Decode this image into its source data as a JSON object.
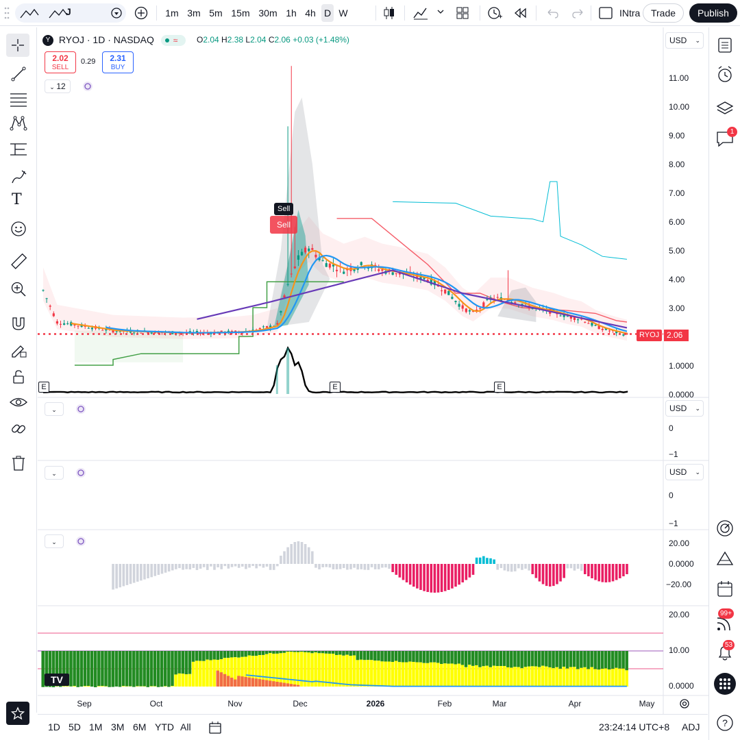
{
  "toolbar": {
    "symbol_partial": "J",
    "intervals": [
      "1m",
      "3m",
      "5m",
      "15m",
      "30m",
      "1h",
      "4h",
      "D",
      "W"
    ],
    "active_interval": "D",
    "indicators_label": "INtra",
    "trade_label": "Trade",
    "publish_label": "Publish"
  },
  "legend": {
    "logo_letter": "Y",
    "title": "RYOJ · 1D · NASDAQ",
    "o_label": "O",
    "o_val": "2.04",
    "h_label": "H",
    "h_val": "2.38",
    "l_label": "L",
    "l_val": "2.04",
    "c_label": "C",
    "c_val": "2.06",
    "change": "+0.03 (+1.48%)",
    "sell_price": "2.02",
    "sell_label": "SELL",
    "spread": "0.29",
    "buy_price": "2.31",
    "buy_label": "BUY",
    "collapse_count": "12"
  },
  "price_axis": {
    "currency": "USD",
    "ticks": [
      "11.00",
      "10.00",
      "9.00",
      "8.00",
      "7.00",
      "6.00",
      "5.00",
      "4.00",
      "3.00",
      "1.0000",
      "0.0000"
    ],
    "current_symbol": "RYOJ",
    "current_price": "2.06"
  },
  "pane2": {
    "currency": "USD",
    "ticks": [
      "0",
      "−1"
    ]
  },
  "pane3": {
    "currency": "USD",
    "ticks": [
      "0",
      "−1"
    ]
  },
  "pane4": {
    "ticks": [
      "20.00",
      "0.0000",
      "−20.00"
    ]
  },
  "pane5": {
    "ticks": [
      "20.00",
      "10.00",
      "0.0000"
    ]
  },
  "signals": {
    "sell_tooltip": "Sell",
    "sell_flag": "Sell"
  },
  "earnings_marker": "E",
  "time_axis": [
    "Sep",
    "Oct",
    "Nov",
    "Dec",
    "2026",
    "Feb",
    "Mar",
    "Apr",
    "May"
  ],
  "bottom": {
    "ranges": [
      "1D",
      "5D",
      "1M",
      "3M",
      "6M",
      "YTD",
      "All"
    ],
    "clock": "23:24:14 UTC+8",
    "adj": "ADJ"
  },
  "right_badges": {
    "chat": "1",
    "feed": "99+",
    "alerts": "53"
  },
  "colors": {
    "up": "#089981",
    "down": "#f23645",
    "accent": "#2962ff",
    "ma_orange": "#f7931a",
    "ma_blue": "#2196f3",
    "ma_purple": "#673ab7",
    "histogram_pink": "#e91e63",
    "histogram_cyan": "#00bcd4",
    "yellow": "#ffff00",
    "green": "#228b22"
  },
  "chart_data": {
    "type": "candlestick",
    "x": [
      "Sep",
      "Oct",
      "Nov",
      "Dec",
      "2026",
      "Feb",
      "Mar",
      "Apr"
    ],
    "close": [
      2.1,
      2.15,
      4.6,
      4.1,
      3.2,
      2.8,
      2.5,
      2.06
    ],
    "high": [
      2.6,
      2.3,
      11.4,
      6.3,
      4.1,
      3.3,
      4.3,
      2.6
    ],
    "low": [
      1.9,
      2.0,
      2.2,
      3.4,
      2.5,
      2.5,
      2.0,
      2.04
    ],
    "ylim": [
      0,
      11.5
    ]
  }
}
